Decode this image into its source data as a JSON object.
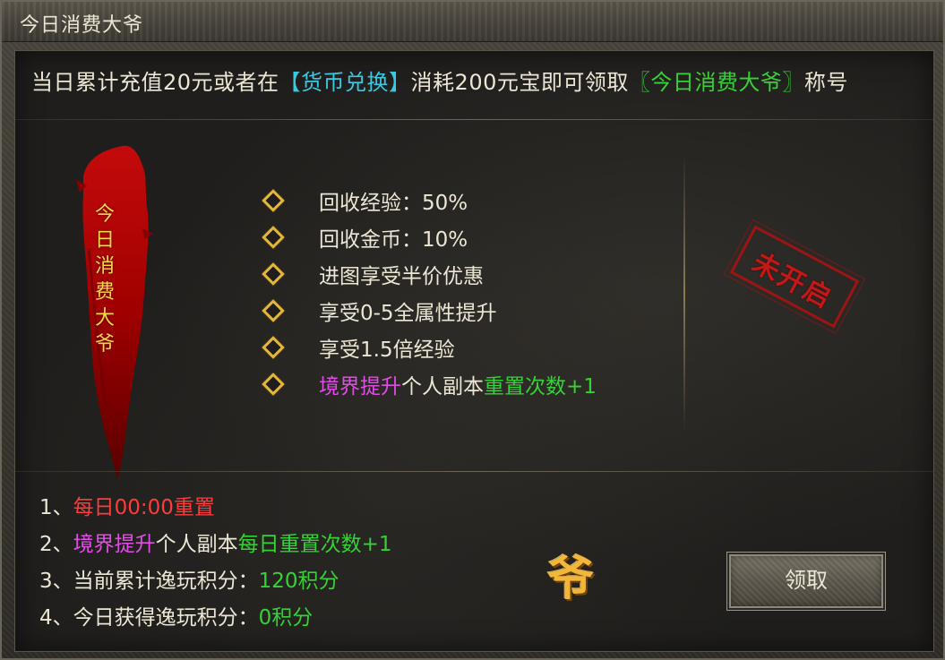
{
  "window": {
    "title": "今日消费大爷"
  },
  "intro": {
    "part1": "当日累计充值20元或者在",
    "link1": "【货币兑换】",
    "part2": "消耗200元宝即可领取",
    "link2": "〖今日消费大爷〗",
    "part3": "称号"
  },
  "banner": {
    "chars": [
      "今",
      "日",
      "消",
      "费",
      "大",
      "爷"
    ]
  },
  "perks": [
    {
      "text": "回收经验：50%"
    },
    {
      "text": "回收金币：10%"
    },
    {
      "text": "进图享受半价优惠"
    },
    {
      "text": "享受0-5全属性提升"
    },
    {
      "text": "享受1.5倍经验"
    },
    {
      "a": "境界提升",
      "b": "个人副本",
      "c": "重置次数+1"
    }
  ],
  "stamp": {
    "text": "未开启"
  },
  "notes": [
    {
      "num": "1、",
      "text": "每日00:00重置"
    },
    {
      "num": "2、",
      "a": "境界提升",
      "b": "个人副本",
      "c": "每日重置次数+1"
    },
    {
      "num": "3、",
      "label": "当前累计逸玩积分：",
      "value": "120积分"
    },
    {
      "num": "4、",
      "label": "今日获得逸玩积分：",
      "value": "0积分"
    }
  ],
  "emblem": {
    "text": "爷"
  },
  "claim_button": {
    "label": "领取"
  },
  "colors": {
    "accent_cyan": "#37c9e2",
    "accent_green": "#35d235",
    "accent_red": "#ff3b3b",
    "accent_magenta": "#e04de5",
    "gold": "#e3b73a"
  }
}
